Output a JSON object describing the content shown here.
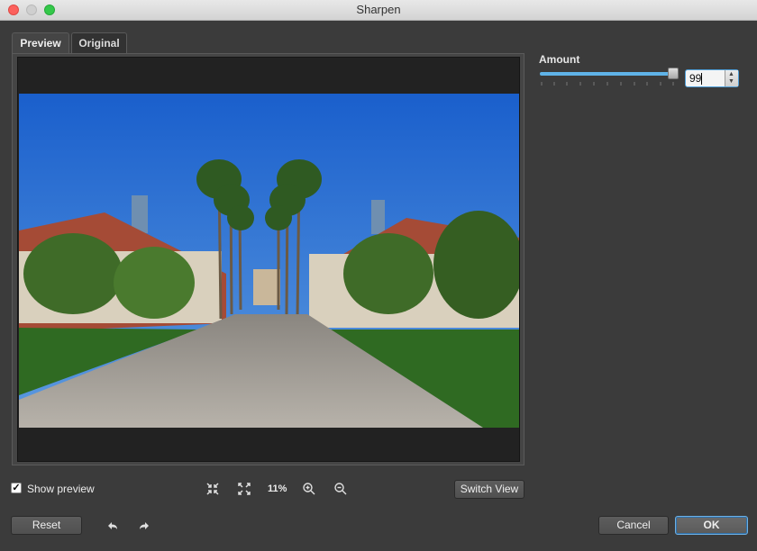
{
  "window": {
    "title": "Sharpen"
  },
  "tabs": [
    {
      "label": "Preview",
      "active": true
    },
    {
      "label": "Original",
      "active": false
    }
  ],
  "amount": {
    "label": "Amount",
    "value": "99",
    "slider_fraction": 0.99
  },
  "controls": {
    "show_preview_label": "Show preview",
    "show_preview_checked": true,
    "show_preview_check_glyph": "✓",
    "zoom_level": "11%",
    "switch_view_label": "Switch View"
  },
  "buttons": {
    "reset": "Reset",
    "cancel": "Cancel",
    "ok": "OK"
  },
  "icons": {
    "fit": "fit-to-window-icon",
    "actual": "actual-size-icon",
    "zoom_in": "zoom-in-icon",
    "zoom_out": "zoom-out-icon",
    "undo": "undo-icon",
    "redo": "redo-icon"
  },
  "colors": {
    "accent": "#4f9fd9",
    "slider_fill": "#5fb3e8",
    "sky": "#1f6fd0",
    "grass": "#2f6a22"
  }
}
